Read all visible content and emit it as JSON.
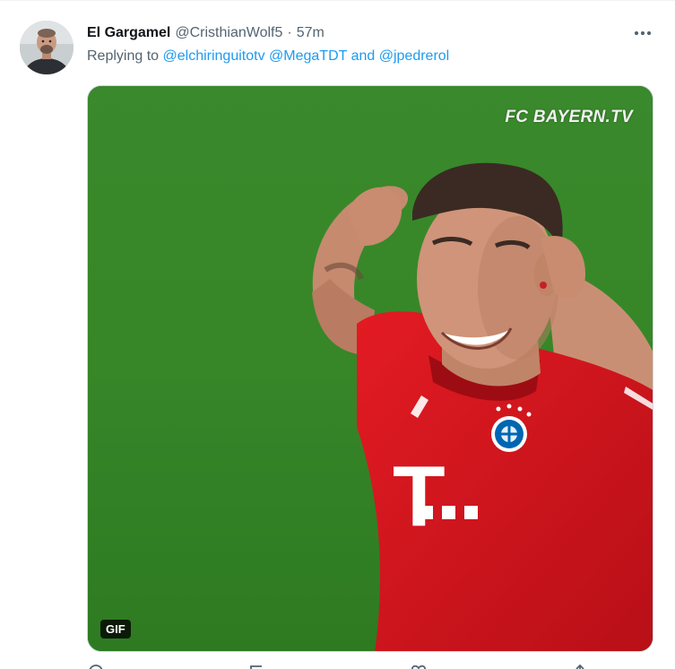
{
  "tweet": {
    "author_name": "El Gargamel",
    "author_handle": "@CristhianWolf5",
    "separator": "·",
    "timestamp": "57m",
    "replying_prefix": "Replying to",
    "mentions": [
      "@elchiringuitotv",
      "@MegaTDT"
    ],
    "mention_joiner": "and",
    "last_mention": "@jpedrerol",
    "more_icon": "more-horizontal-icon"
  },
  "media": {
    "type": "gif",
    "watermark": "FC BAYERN.TV",
    "badge": "GIF",
    "jersey_letter": "T"
  },
  "actions": [
    "reply-icon",
    "retweet-icon",
    "like-icon",
    "share-icon"
  ],
  "colors": {
    "link": "#1d9bf0",
    "secondary_text": "#536471",
    "primary_text": "#0f1419",
    "pitch_green": "#3b8a2c",
    "jersey_red": "#d9161e"
  }
}
